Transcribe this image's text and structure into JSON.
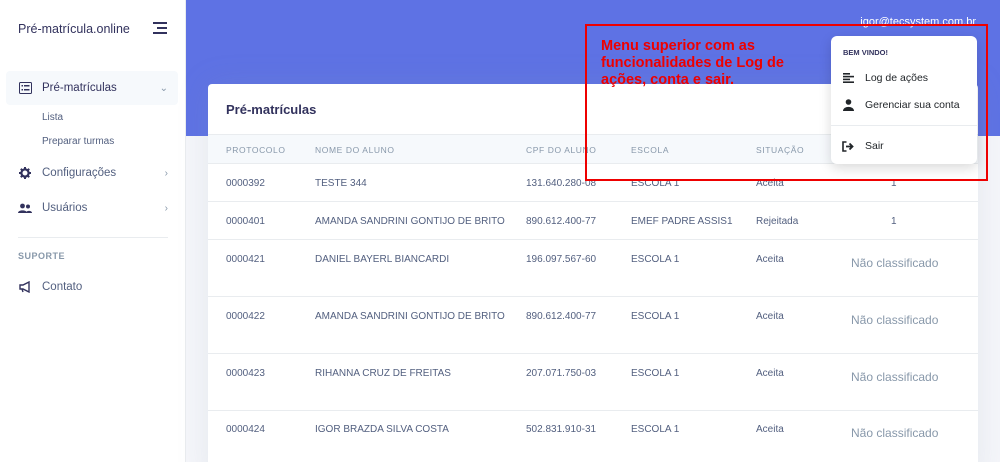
{
  "app": {
    "brand": "Pré-matrícula.online"
  },
  "sidebar": {
    "items": [
      {
        "label": "Pré-matrículas",
        "icon": "list-icon"
      },
      {
        "label": "Configurações",
        "icon": "gear-icon"
      },
      {
        "label": "Usuários",
        "icon": "users-icon"
      }
    ],
    "sub_items": [
      {
        "label": "Lista"
      },
      {
        "label": "Preparar turmas"
      }
    ],
    "section_label": "SUPORTE",
    "support_items": [
      {
        "label": "Contato",
        "icon": "megaphone-icon"
      }
    ]
  },
  "header": {
    "user_email": "igor@tecsystem.com.br"
  },
  "card": {
    "title": "Pré-matrículas",
    "columns": [
      "PROTOCOLO",
      "NOME DO ALUNO",
      "CPF DO ALUNO",
      "ESCOLA",
      "SITUAÇÃO"
    ],
    "rows": [
      {
        "protocolo": "0000392",
        "nome": "TESTE 344",
        "cpf": "131.640.280-08",
        "escola": "ESCOLA 1",
        "situacao": "Aceita",
        "extra": "1"
      },
      {
        "protocolo": "0000401",
        "nome": "AMANDA SANDRINI GONTIJO DE BRITO",
        "cpf": "890.612.400-77",
        "escola": "EMEF PADRE ASSIS1",
        "situacao": "Rejeitada",
        "extra": "1"
      },
      {
        "protocolo": "0000421",
        "nome": "DANIEL BAYERL BIANCARDI",
        "cpf": "196.097.567-60",
        "escola": "ESCOLA 1",
        "situacao": "Aceita",
        "extra": "Não classificado"
      },
      {
        "protocolo": "0000422",
        "nome": "AMANDA SANDRINI GONTIJO DE BRITO",
        "cpf": "890.612.400-77",
        "escola": "ESCOLA 1",
        "situacao": "Aceita",
        "extra": "Não classificado"
      },
      {
        "protocolo": "0000423",
        "nome": "RIHANNA CRUZ DE FREITAS",
        "cpf": "207.071.750-03",
        "escola": "ESCOLA 1",
        "situacao": "Aceita",
        "extra": "Não classificado"
      },
      {
        "protocolo": "0000424",
        "nome": "IGOR BRAZDA SILVA COSTA",
        "cpf": "502.831.910-31",
        "escola": "ESCOLA 1",
        "situacao": "Aceita",
        "extra": "Não classificado"
      }
    ]
  },
  "dropdown": {
    "header": "BEM VINDO!",
    "items": [
      {
        "label": "Log de ações",
        "icon": "log-lines-icon"
      },
      {
        "label": "Gerenciar sua conta",
        "icon": "user-icon"
      },
      {
        "label": "Sair",
        "icon": "logout-icon"
      }
    ]
  },
  "annotation": {
    "text": "Menu superior com as funcionalidades de Log de ações, conta e sair.",
    "color": "#ee0000"
  },
  "colors": {
    "header": "#5e72e4",
    "annotation": "#ee0000"
  }
}
